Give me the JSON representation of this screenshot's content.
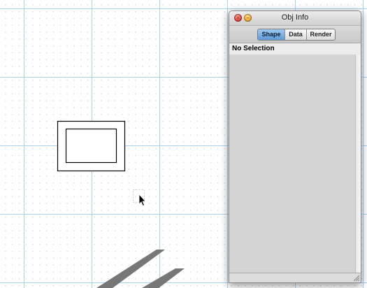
{
  "canvas": {
    "grid_color": "#a9d2ee",
    "dot_color": "#c9d3df",
    "stripe_color": "#777777"
  },
  "inspector": {
    "title": "Obj Info",
    "tabs": [
      {
        "label": "Shape",
        "selected": true
      },
      {
        "label": "Data",
        "selected": false
      },
      {
        "label": "Render",
        "selected": false
      }
    ],
    "selection_text": "No Selection",
    "close_icon": "close-icon",
    "minimize_icon": "minimize-icon"
  }
}
